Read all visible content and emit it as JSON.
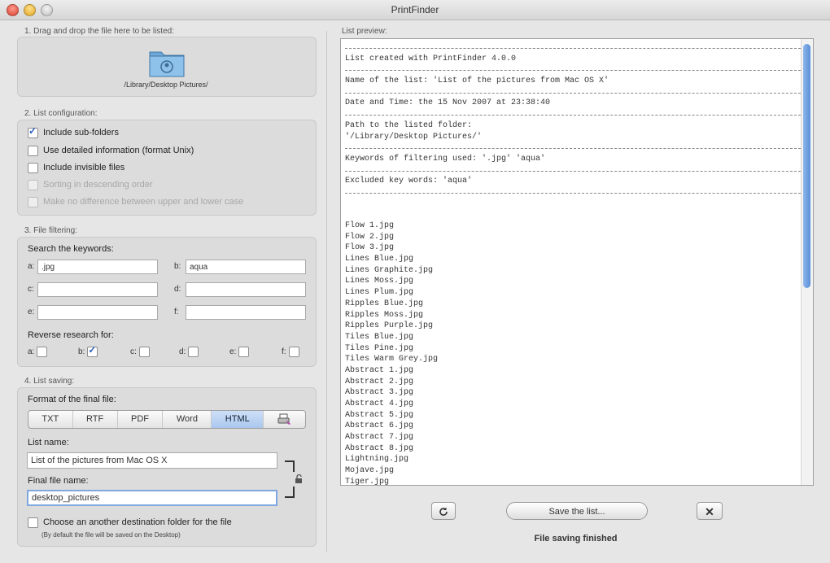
{
  "window": {
    "title": "PrintFinder"
  },
  "drop": {
    "label": "1. Drag and drop the file here to be listed:",
    "path": "/Library/Desktop Pictures/",
    "icon": "folder-icon"
  },
  "config": {
    "label": "2. List configuration:",
    "options": [
      {
        "label": "Include sub-folders",
        "checked": true,
        "enabled": true
      },
      {
        "label": "Use detailed information (format Unix)",
        "checked": false,
        "enabled": true
      },
      {
        "label": "Include invisible files",
        "checked": false,
        "enabled": true
      },
      {
        "label": "Sorting in descending order",
        "checked": false,
        "enabled": false
      },
      {
        "label": "Make no difference between upper and lower case",
        "checked": false,
        "enabled": false
      }
    ]
  },
  "filter": {
    "label": "3. File filtering:",
    "keywords_label": "Search the keywords:",
    "fields": [
      {
        "letter": "a:",
        "value": ".jpg"
      },
      {
        "letter": "b:",
        "value": "aqua"
      },
      {
        "letter": "c:",
        "value": ""
      },
      {
        "letter": "d:",
        "value": ""
      },
      {
        "letter": "e:",
        "value": ""
      },
      {
        "letter": "f:",
        "value": ""
      }
    ],
    "reverse_label": "Reverse research for:",
    "reverse": [
      {
        "letter": "a:",
        "checked": false
      },
      {
        "letter": "b:",
        "checked": true
      },
      {
        "letter": "c:",
        "checked": false
      },
      {
        "letter": "d:",
        "checked": false
      },
      {
        "letter": "e:",
        "checked": false
      },
      {
        "letter": "f:",
        "checked": false
      }
    ]
  },
  "saving": {
    "label": "4. List saving:",
    "format_label": "Format of the final file:",
    "formats": [
      "TXT",
      "RTF",
      "PDF",
      "Word",
      "HTML"
    ],
    "selected_format": "HTML",
    "list_name_label": "List name:",
    "list_name": "List of the pictures from Mac OS X",
    "file_name_label": "Final file name:",
    "file_name": "desktop_pictures",
    "destination_label": "Choose an another destination folder for the file",
    "destination_note": "(By default the file will be saved on the Desktop)"
  },
  "preview": {
    "label": "List preview:",
    "lines": [
      "---",
      "List created with PrintFinder 4.0.0",
      "---",
      "Name of the list: 'List of the pictures from Mac OS X'",
      "---",
      "Date and Time: the 15 Nov 2007 at 23:38:40",
      "---",
      "Path to the listed folder:",
      "'/Library/Desktop Pictures/'",
      "---",
      "Keywords of filtering used: '.jpg' 'aqua'",
      "---",
      "Excluded key words: 'aqua'",
      "---",
      "",
      "",
      "Flow 1.jpg",
      "Flow 2.jpg",
      "Flow 3.jpg",
      "Lines Blue.jpg",
      "Lines Graphite.jpg",
      "Lines Moss.jpg",
      "Lines Plum.jpg",
      "Ripples Blue.jpg",
      "Ripples Moss.jpg",
      "Ripples Purple.jpg",
      "Tiles Blue.jpg",
      "Tiles Pine.jpg",
      "Tiles Warm Grey.jpg",
      "Abstract 1.jpg",
      "Abstract 2.jpg",
      "Abstract 3.jpg",
      "Abstract 4.jpg",
      "Abstract 5.jpg",
      "Abstract 6.jpg",
      "Abstract 7.jpg",
      "Abstract 8.jpg",
      "Lightning.jpg",
      "Mojave.jpg",
      "Tiger.jpg"
    ]
  },
  "actions": {
    "refresh_icon": "refresh-icon",
    "save_label": "Save the list...",
    "close_icon": "close-icon",
    "status": "File saving finished"
  },
  "colors": {
    "accent": "#5a8fd8",
    "selected_segment": "#aac7ee"
  }
}
